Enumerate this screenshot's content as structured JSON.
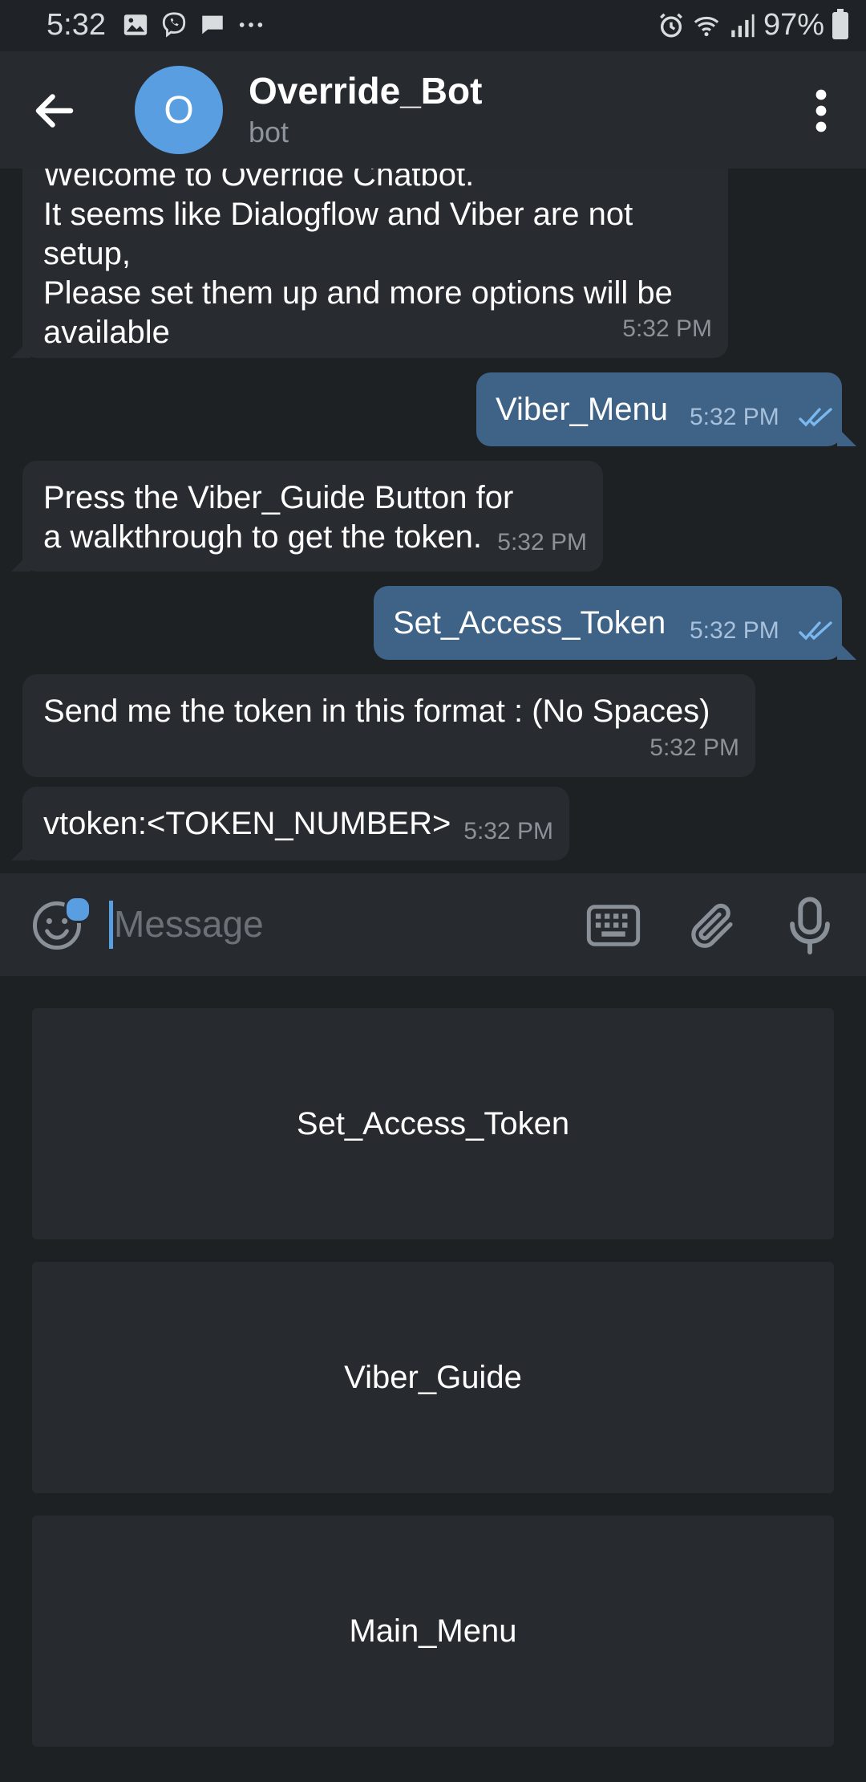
{
  "status_bar": {
    "time": "5:32",
    "battery_percent": "97%",
    "icons": [
      "image-icon",
      "viber-icon",
      "chat-icon",
      "more-dots-icon",
      "alarm-icon",
      "wifi-icon",
      "signal-icon",
      "battery-icon"
    ]
  },
  "header": {
    "avatar_letter": "O",
    "title": "Override_Bot",
    "subtitle": "bot"
  },
  "messages": [
    {
      "dir": "in",
      "text": "Welcome to Override Chatbot.\nIt seems like Dialogflow and Viber are not setup,\nPlease set them up and more options will be available",
      "time": "5:32 PM"
    },
    {
      "dir": "out",
      "text": "Viber_Menu",
      "time": "5:32 PM",
      "read": true
    },
    {
      "dir": "in",
      "text": "Press the Viber_Guide Button for a walkthrough to get the token.",
      "time": "5:32 PM"
    },
    {
      "dir": "out",
      "text": "Set_Access_Token",
      "time": "5:32 PM",
      "read": true
    },
    {
      "dir": "in",
      "text": "Send me the token in this format : (No Spaces)",
      "time": "5:32 PM"
    },
    {
      "dir": "in",
      "text": "vtoken:<TOKEN_NUMBER>",
      "time": "5:32 PM"
    }
  ],
  "input": {
    "placeholder": "Message",
    "value": ""
  },
  "bot_keyboard": {
    "buttons": [
      "Set_Access_Token",
      "Viber_Guide",
      "Main_Menu"
    ]
  },
  "colors": {
    "accent": "#5a9ee2",
    "outgoing_bubble": "#3f6287",
    "incoming_bubble": "#282c31",
    "header": "#272b30",
    "background": "#1e2124"
  }
}
